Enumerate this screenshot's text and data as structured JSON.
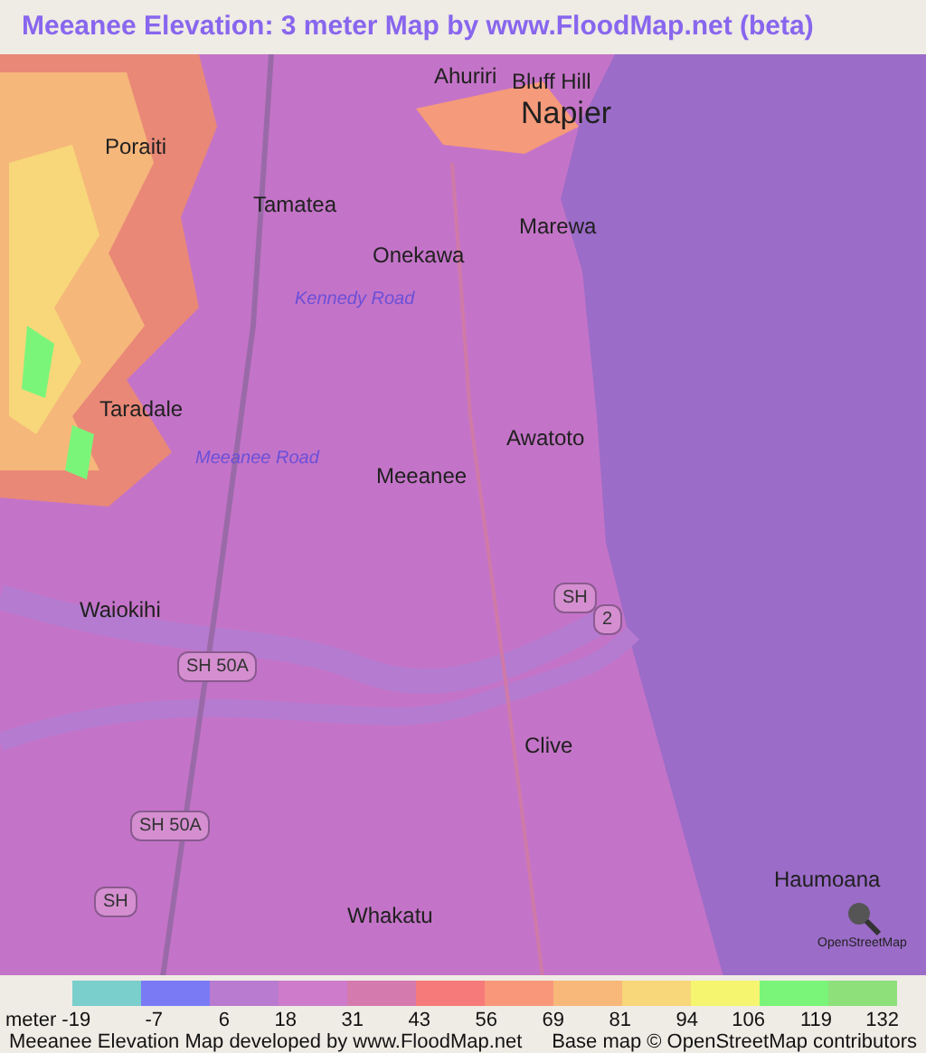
{
  "title": "Meeanee Elevation: 3 meter Map by www.FloodMap.net (beta)",
  "map": {
    "places": [
      {
        "name": "Ahuriri"
      },
      {
        "name": "Bluff Hill"
      },
      {
        "name": "Napier"
      },
      {
        "name": "Poraiti"
      },
      {
        "name": "Tamatea"
      },
      {
        "name": "Onekawa"
      },
      {
        "name": "Marewa"
      },
      {
        "name": "Taradale"
      },
      {
        "name": "Awatoto"
      },
      {
        "name": "Meeanee"
      },
      {
        "name": "Waiokihi"
      },
      {
        "name": "Clive"
      },
      {
        "name": "Whakatu"
      },
      {
        "name": "Haumoana"
      }
    ],
    "roads": [
      {
        "name": "Kennedy Road"
      },
      {
        "name": "Meeanee Road"
      }
    ],
    "shields": [
      {
        "text": "SH"
      },
      {
        "text": "2"
      },
      {
        "text": "SH 50A"
      },
      {
        "text": "SH 50A"
      },
      {
        "text": "SH"
      }
    ],
    "logo_text": "OpenStreetMap"
  },
  "legend": {
    "swatches": [
      {
        "color": "#7acfcc"
      },
      {
        "color": "#7a7af5"
      },
      {
        "color": "#b97bd0"
      },
      {
        "color": "#cd7bca"
      },
      {
        "color": "#d57aae"
      },
      {
        "color": "#f77a7a"
      },
      {
        "color": "#f8977a"
      },
      {
        "color": "#f8b87a"
      },
      {
        "color": "#f8d77a"
      },
      {
        "color": "#f5f570"
      },
      {
        "color": "#7af57a"
      },
      {
        "color": "#8de07a"
      }
    ],
    "ticks": [
      "meter -19",
      "-7",
      "6",
      "18",
      "31",
      "43",
      "56",
      "69",
      "81",
      "94",
      "106",
      "119",
      "132"
    ]
  },
  "footer": {
    "left": "Meeanee Elevation Map developed by www.FloodMap.net",
    "right": "Base map © OpenStreetMap contributors"
  }
}
